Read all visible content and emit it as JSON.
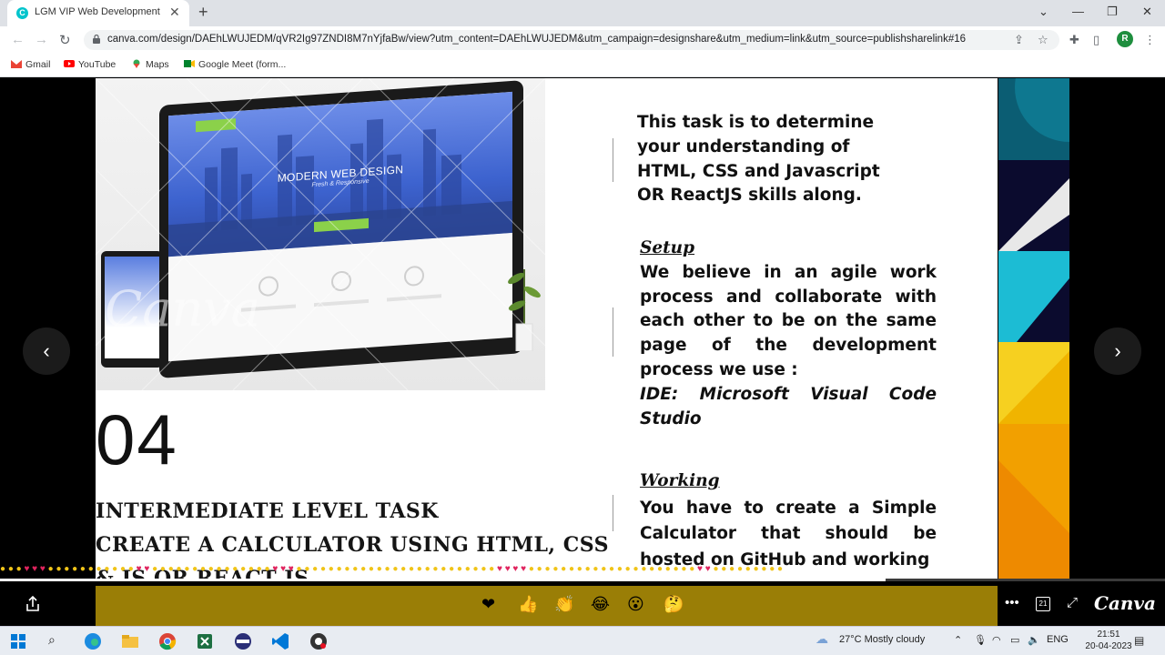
{
  "browser": {
    "tab_title": "LGM VIP Web Development",
    "url": "canva.com/design/DAEhLWUJEDM/qVR2Ig97ZNDI8M7nYjfaBw/view?utm_content=DAEhLWUJEDM&utm_campaign=designshare&utm_medium=link&utm_source=publishsharelink#16",
    "profile_initial": "R",
    "bookmarks": [
      "Gmail",
      "YouTube",
      "Maps",
      "Google Meet (form..."
    ]
  },
  "slide": {
    "mockup": {
      "hero_title": "MODERN WEB DESIGN",
      "hero_subtitle": "Fresh & Responsive",
      "watermark": "Canva"
    },
    "number": "04",
    "task_lines": [
      "INTERMEDIATE LEVEL TASK",
      "CREATE A CALCULATOR USING HTML, CSS",
      "& JS OR REACT JS"
    ],
    "intro": "This task is to determine your understanding of HTML, CSS and Javascript OR ReactJS skills along.",
    "setup_heading": "Setup",
    "setup_text": "We believe in an agile work process and collaborate with each other to be on the same page of the development process we use :",
    "ide_text": "IDE: Microsoft Visual Code Studio",
    "working_heading": "Working",
    "working_text": "You have to create a Simple Calculator that should be hosted on GitHub and working"
  },
  "viewer": {
    "progress_fraction": 0.76,
    "reactions": [
      "❤",
      "👍",
      "👏",
      "😂",
      "😮",
      "🤔"
    ],
    "page_count": "21",
    "brand": "Canva"
  },
  "taskbar": {
    "weather": "27°C  Mostly cloudy",
    "language": "ENG",
    "time": "21:51",
    "date": "20-04-2023"
  },
  "colors": {
    "tab_strip": "#dee1e6",
    "reaction_panel": "#9a7e06",
    "hero_blue": "#3d63cf",
    "accent_green": "#8bd14a",
    "profile_green": "#1e8e3e"
  }
}
